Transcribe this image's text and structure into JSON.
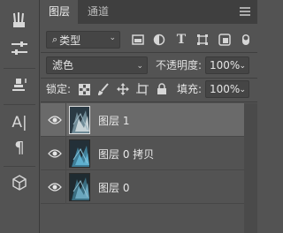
{
  "toolstrip": {
    "tools": [
      {
        "name": "brushes-icon"
      },
      {
        "name": "adjust-sliders-icon"
      },
      {
        "name": "clone-source-icon"
      },
      {
        "name": "character-icon",
        "glyph": "A|"
      },
      {
        "name": "paragraph-icon",
        "glyph": "¶"
      },
      {
        "name": "3d-cube-icon"
      }
    ]
  },
  "panel": {
    "tabs": [
      {
        "label": "图层",
        "active": true
      },
      {
        "label": "通道",
        "active": false
      }
    ],
    "filter": {
      "kind_label": "类型",
      "icons": [
        "pixel-filter-icon",
        "adjustment-filter-icon",
        "type-filter-icon",
        "shape-filter-icon",
        "smart-object-filter-icon"
      ],
      "type_glyph": "T"
    },
    "blend_mode": "滤色",
    "opacity_label": "不透明度:",
    "opacity_value": "100%",
    "lock_label": "锁定:",
    "fill_label": "填充:",
    "fill_value": "100%",
    "layers": [
      {
        "name": "图层 1",
        "selected": true,
        "visible": true
      },
      {
        "name": "图层 0 拷贝",
        "selected": false,
        "visible": true
      },
      {
        "name": "图层 0",
        "selected": false,
        "visible": true
      }
    ]
  },
  "colors": {
    "panel_bg": "#535353",
    "tab_bar_bg": "#3f3f3f",
    "selected_row": "#6a6a6a",
    "field_bg": "#454545"
  }
}
